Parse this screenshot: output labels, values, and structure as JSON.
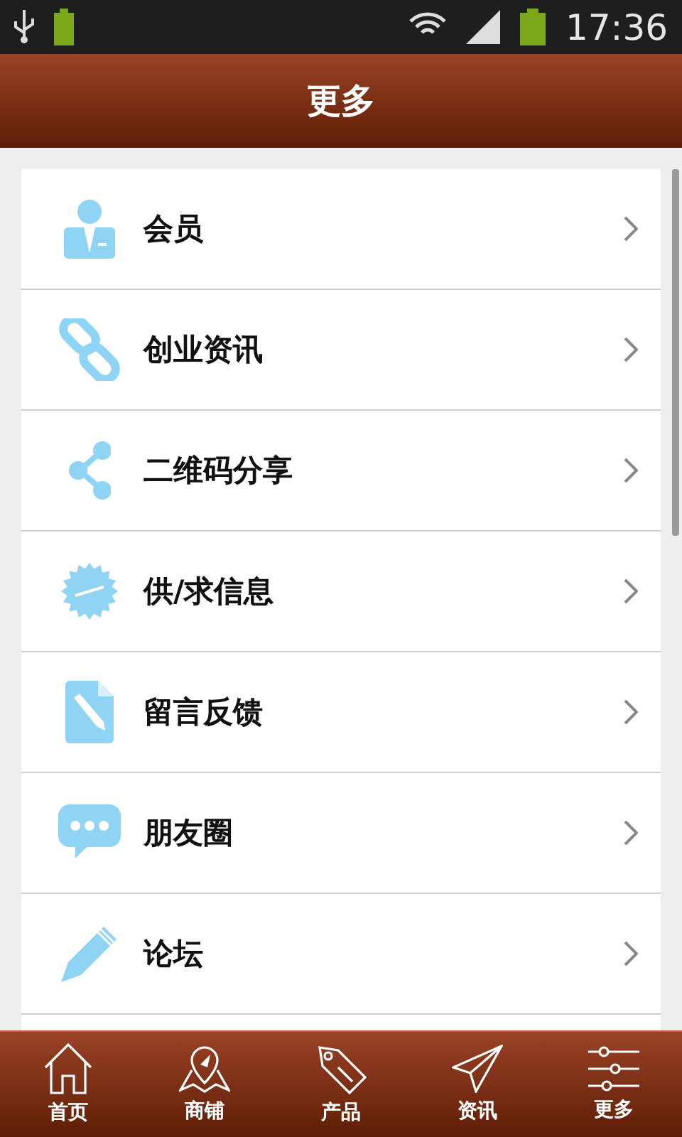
{
  "status_bar": {
    "time": "17:36"
  },
  "header": {
    "title": "更多"
  },
  "menu": [
    {
      "kind": "member",
      "label": "会员"
    },
    {
      "kind": "link",
      "label": "创业资讯"
    },
    {
      "kind": "share",
      "label": "二维码分享"
    },
    {
      "kind": "new",
      "label": "供/求信息"
    },
    {
      "kind": "note",
      "label": "留言反馈"
    },
    {
      "kind": "chat",
      "label": "朋友圈"
    },
    {
      "kind": "pencil",
      "label": "论坛"
    }
  ],
  "tab_bar": [
    {
      "kind": "home",
      "label": "首页"
    },
    {
      "kind": "map",
      "label": "商铺"
    },
    {
      "kind": "tag",
      "label": "产品"
    },
    {
      "kind": "send",
      "label": "资讯"
    },
    {
      "kind": "sliders",
      "label": "更多"
    }
  ]
}
